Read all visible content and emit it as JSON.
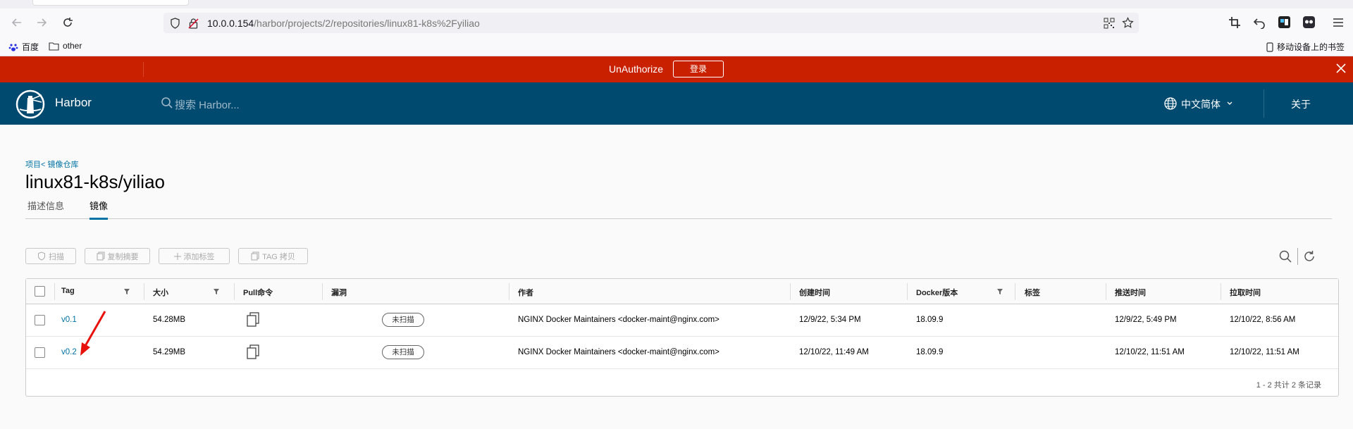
{
  "browser": {
    "url_host": "10.0.0.154",
    "url_path": "/harbor/projects/2/repositories/linux81-k8s%2Fyiliao",
    "bookmarks": [
      {
        "label": "百度",
        "icon": "baidu-paw-icon"
      },
      {
        "label": "other",
        "icon": "folder-icon"
      }
    ],
    "mobile_bookmarks_label": "移动设备上的书签"
  },
  "banner": {
    "message": "UnAuthorize",
    "login_label": "登录",
    "color": "#c92100"
  },
  "header": {
    "brand": "Harbor",
    "search_placeholder": "搜索 Harbor...",
    "language": "中文简体",
    "about": "关于",
    "color": "#004a70"
  },
  "breadcrumb": "项目< 镜像仓库",
  "repo_title": "linux81-k8s/yiliao",
  "tabs": [
    {
      "label": "描述信息",
      "active": false
    },
    {
      "label": "镜像",
      "active": true
    }
  ],
  "toolbar": {
    "scan": "扫描",
    "copy_digest": "复制摘要",
    "add_label": "添加标签",
    "tag_copy": "TAG 拷贝"
  },
  "table": {
    "columns": [
      "Tag",
      "大小",
      "Pull命令",
      "漏洞",
      "作者",
      "创建时间",
      "Docker版本",
      "标签",
      "推送时间",
      "拉取时间"
    ],
    "rows": [
      {
        "tag": "v0.1",
        "size": "54.28MB",
        "vulnerability": "未扫描",
        "author": "NGINX Docker Maintainers <docker-maint@nginx.com>",
        "created": "12/9/22, 5:34 PM",
        "docker_version": "18.09.9",
        "labels": "",
        "pushed": "12/9/22, 5:49 PM",
        "pulled": "12/10/22, 8:56 AM"
      },
      {
        "tag": "v0.2",
        "size": "54.29MB",
        "vulnerability": "未扫描",
        "author": "NGINX Docker Maintainers <docker-maint@nginx.com>",
        "created": "12/10/22, 11:49 AM",
        "docker_version": "18.09.9",
        "labels": "",
        "pushed": "12/10/22, 11:51 AM",
        "pulled": "12/10/22, 11:51 AM"
      }
    ],
    "footer": "1 - 2 共计 2 条记录"
  },
  "accent_color": "#0072a3"
}
